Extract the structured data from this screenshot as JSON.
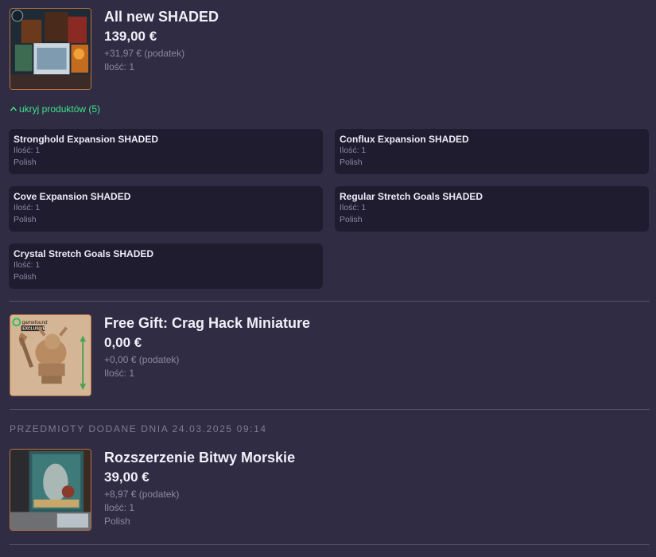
{
  "products": [
    {
      "title": "All new SHADED",
      "price": "139,00 €",
      "tax": "+31,97 € (podatek)",
      "quantity": "Ilość: 1"
    },
    {
      "title": "Free Gift: Crag Hack Miniature",
      "price": "0,00 €",
      "tax": "+0,00 € (podatek)",
      "quantity": "Ilość: 1",
      "badge_brand": "gamefound",
      "badge_text": "EXCLUSIVE"
    },
    {
      "title": "Rozszerzenie Bitwy Morskie",
      "price": "39,00 €",
      "tax": "+8,97 € (podatek)",
      "quantity": "Ilość: 1",
      "language": "Polish"
    }
  ],
  "toggle": {
    "label": "ukryj produktów (5)"
  },
  "bundle_items": [
    {
      "name": "Stronghold Expansion SHADED",
      "quantity": "Ilość: 1",
      "language": "Polish"
    },
    {
      "name": "Conflux Expansion SHADED",
      "quantity": "Ilość: 1",
      "language": "Polish"
    },
    {
      "name": "Cove Expansion SHADED",
      "quantity": "Ilość: 1",
      "language": "Polish"
    },
    {
      "name": "Regular Stretch Goals SHADED",
      "quantity": "Ilość: 1",
      "language": "Polish"
    },
    {
      "name": "Crystal Stretch Goals SHADED",
      "quantity": "Ilość: 1",
      "language": "Polish"
    }
  ],
  "section_heading": "PRZEDMIOTY DODANE DNIA 24.03.2025 09:14",
  "colors": {
    "background": "#302c44",
    "card": "#1f1c30",
    "accent_green": "#3ee48a",
    "muted_text": "#8c88a3",
    "thumb_border": "#b8713f"
  },
  "icons": {
    "toggle": "chevron-up-icon"
  }
}
